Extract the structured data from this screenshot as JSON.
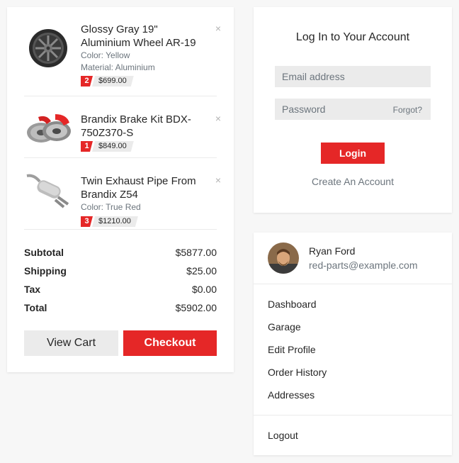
{
  "cart": {
    "items": [
      {
        "name": "Glossy Gray 19\" Aluminium Wheel AR-19",
        "options": [
          "Color: Yellow",
          "Material: Aluminium"
        ],
        "qty": "2",
        "price": "$699.00",
        "image": "wheel-image"
      },
      {
        "name": "Brandix Brake Kit BDX-750Z370-S",
        "options": [],
        "qty": "1",
        "price": "$849.00",
        "image": "brake-kit-image"
      },
      {
        "name": "Twin Exhaust Pipe From Brandix Z54",
        "options": [
          "Color: True Red"
        ],
        "qty": "3",
        "price": "$1210.00",
        "image": "exhaust-image"
      }
    ],
    "remove_glyph": "×",
    "totals": [
      {
        "label": "Subtotal",
        "value": "$5877.00"
      },
      {
        "label": "Shipping",
        "value": "$25.00"
      },
      {
        "label": "Tax",
        "value": "$0.00"
      },
      {
        "label": "Total",
        "value": "$5902.00"
      }
    ],
    "view_cart_label": "View Cart",
    "checkout_label": "Checkout"
  },
  "login": {
    "title": "Log In to Your Account",
    "email_placeholder": "Email address",
    "password_placeholder": "Password",
    "forgot_label": "Forgot?",
    "login_label": "Login",
    "create_label": "Create An Account"
  },
  "account": {
    "name": "Ryan Ford",
    "email": "red-parts@example.com",
    "menu": [
      "Dashboard",
      "Garage",
      "Edit Profile",
      "Order History",
      "Addresses"
    ],
    "logout_label": "Logout"
  },
  "colors": {
    "accent": "#e52727",
    "muted": "#6c757d",
    "panel": "#ebebeb"
  }
}
